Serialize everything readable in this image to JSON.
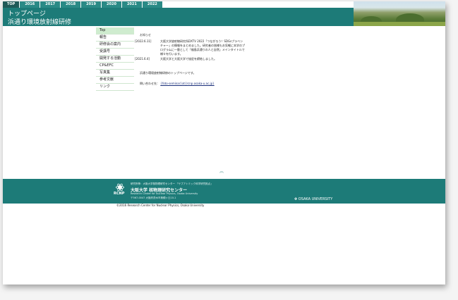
{
  "tabs": [
    "TOP",
    "2016",
    "2017",
    "2018",
    "2019",
    "2020",
    "2021",
    "2022"
  ],
  "header": {
    "title": "トップページ",
    "subtitle": "浜通り環境放射線研修"
  },
  "sidebar": {
    "items": [
      "Top",
      "報告",
      "研修会の案内",
      "受講号",
      "開発する活動",
      "CP&EFC",
      "写真集",
      "参考文献",
      "リンク"
    ]
  },
  "main": {
    "notice_label": "お知らせ",
    "news": [
      {
        "date": "[2022.6.11]",
        "text": "大阪大学放射線研究所DXTV 2022「つながろう！SDGsプラベンチャー」の情報をまとめました。研究者の皆様もお気軽に本学のプログラムに一層として「福島浜通りの人と自然」メインタイトルで様々を行います。"
      },
      {
        "date": "[2021.6.4]",
        "text": "大阪大学と大阪大学で協定を締結しました。"
      }
    ],
    "intro": "浜通り環境放射線研修のトップページです。",
    "contact_label": "問い合わせ先：",
    "contact_link": "{foto-seminar}at{rcnp.osaka-u.ac.jp}"
  },
  "scroll_top_glyph": "︽",
  "footer": {
    "logo_text": "RCNP",
    "line1": "研究所等：大阪大学核物理研究センター 「サブアトミック科学研究拠点」",
    "name": "大阪大学 核物理研究センター",
    "english": "Research Center for Nuclear Physics, Osaka University",
    "address": "〒567-0047 大阪府茨木市美穂ヶ丘10-1",
    "university": "OSAKA UNIVERSITY",
    "copyright": "©2016 Research Center for Nuclear Physics, Osaka University"
  },
  "colors": {
    "teal": "#1d7b78",
    "sidebar_active": "#cfeccf"
  }
}
